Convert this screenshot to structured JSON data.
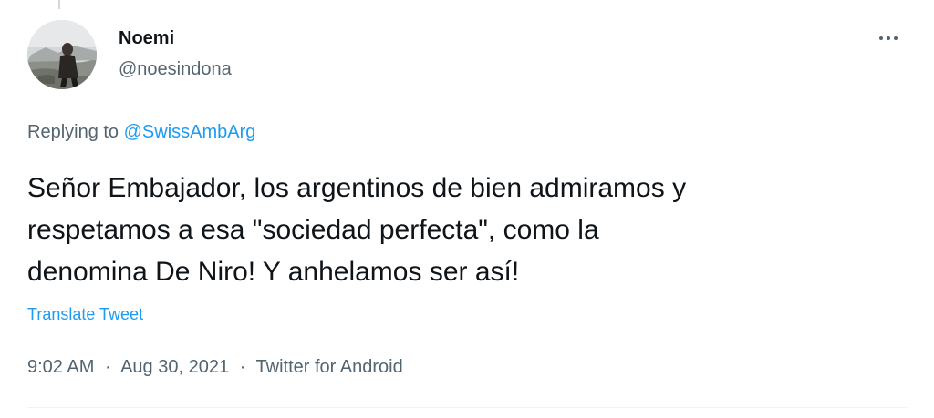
{
  "author": {
    "name": "Noemi",
    "handle": "@noesindona"
  },
  "reply": {
    "prefix": "Replying to ",
    "mention": "@SwissAmbArg"
  },
  "tweet": {
    "text_line1": "Señor Embajador, los argentinos de bien admiramos y",
    "text_line2": "respetamos a esa \"sociedad perfecta\", como la",
    "text_line3": "denomina De Niro! Y anhelamos ser así!",
    "translate_label": "Translate Tweet"
  },
  "meta": {
    "time": "9:02 AM",
    "separator": "·",
    "date": "Aug 30, 2021",
    "source": "Twitter for Android"
  },
  "icons": {
    "more": "more-options-icon",
    "avatar": "profile-photo"
  },
  "colors": {
    "text": "#0f1419",
    "secondary": "#536471",
    "link": "#1d9bf0"
  }
}
